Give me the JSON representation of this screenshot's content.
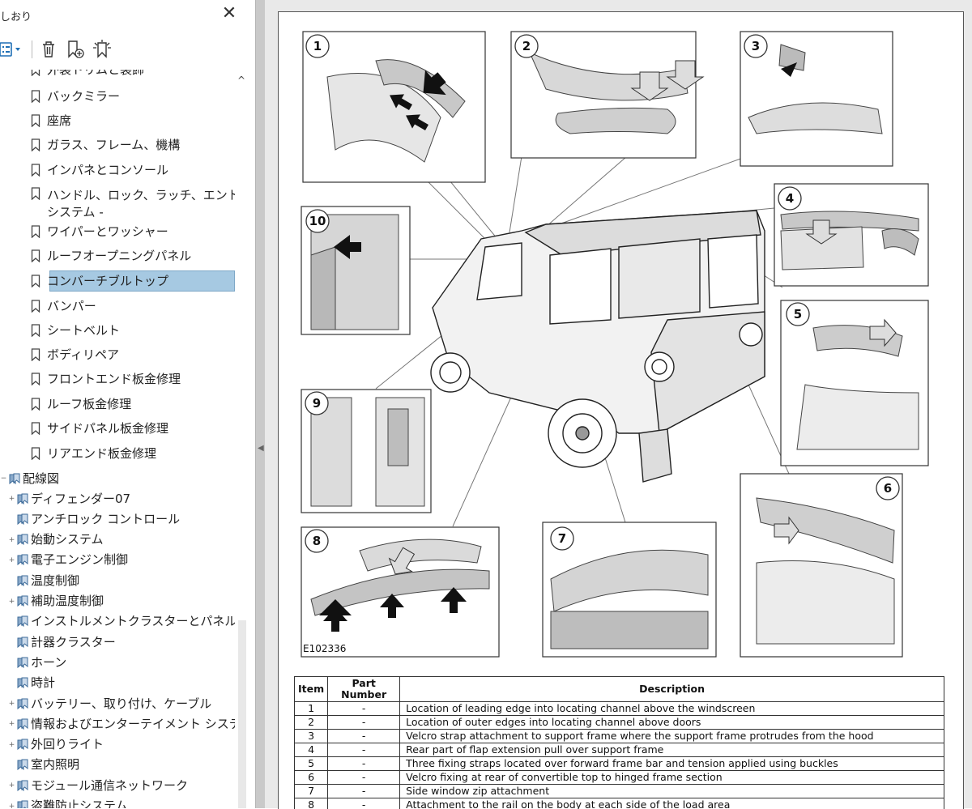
{
  "panel": {
    "title": "しおり",
    "close_glyph": "✕",
    "toolbar": {
      "options_icon": "list-options-icon",
      "delete_icon": "trash-icon",
      "new_bookmark_icon": "new-bookmark-icon",
      "find_bookmark_icon": "find-current-bookmark-icon"
    },
    "bookmarks": [
      {
        "label": "外装トリムと装飾"
      },
      {
        "label": "バックミラー"
      },
      {
        "label": "座席"
      },
      {
        "label": "ガラス、フレーム、機構"
      },
      {
        "label": "インパネとコンソール"
      },
      {
        "label": "ハンドル、ロック、ラッチ、エントリーシステム -",
        "line1": "ハンドル、ロック、ラッチ、エントリー",
        "line2": "システム -"
      },
      {
        "label": "ワイパーとワッシャー"
      },
      {
        "label": "ルーフオープニングパネル"
      },
      {
        "label": "コンバーチブルトップ",
        "selected": true
      },
      {
        "label": "バンパー"
      },
      {
        "label": "シートベルト"
      },
      {
        "label": "ボディリペア"
      },
      {
        "label": "フロントエンド板金修理"
      },
      {
        "label": "ルーフ板金修理"
      },
      {
        "label": "サイドパネル板金修理"
      },
      {
        "label": "リアエンド板金修理"
      }
    ],
    "wiring_section": {
      "label": "配線図",
      "children": [
        {
          "label": "ディフェンダー07",
          "expand": "+"
        },
        {
          "label": "アンチロック コントロール",
          "expand": ""
        },
        {
          "label": "始動システム",
          "expand": "+"
        },
        {
          "label": "電子エンジン制御",
          "expand": "+"
        },
        {
          "label": "温度制御",
          "expand": ""
        },
        {
          "label": "補助温度制御",
          "expand": "+"
        },
        {
          "label": "インストルメントクラスターとパネル照明",
          "expand": ""
        },
        {
          "label": "計器クラスター",
          "expand": ""
        },
        {
          "label": "ホーン",
          "expand": ""
        },
        {
          "label": "時計",
          "expand": ""
        },
        {
          "label": "バッテリー、取り付け、ケーブル",
          "expand": "+"
        },
        {
          "label": "情報およびエンターテイメント システム",
          "expand": "+"
        },
        {
          "label": "外回りライト",
          "expand": "+"
        },
        {
          "label": "室内照明",
          "expand": ""
        },
        {
          "label": "モジュール通信ネットワーク",
          "expand": "+"
        },
        {
          "label": "盗難防止システム",
          "expand": "+"
        }
      ]
    }
  },
  "figure": {
    "callouts": [
      "1",
      "2",
      "3",
      "4",
      "5",
      "6",
      "7",
      "8",
      "9",
      "10"
    ],
    "figure_id": "E102336"
  },
  "table": {
    "headers": {
      "item": "Item",
      "part_number": "Part Number",
      "description": "Description"
    },
    "rows": [
      {
        "item": "1",
        "part": "-",
        "desc": "Location of leading edge into locating channel above the windscreen"
      },
      {
        "item": "2",
        "part": "-",
        "desc": "Location of outer edges into locating channel above doors"
      },
      {
        "item": "3",
        "part": "-",
        "desc": "Velcro strap attachment to support frame where the support frame protrudes from the hood"
      },
      {
        "item": "4",
        "part": "-",
        "desc": "Rear part of flap extension pull over support frame"
      },
      {
        "item": "5",
        "part": "-",
        "desc": "Three fixing straps located over forward frame bar and tension applied using buckles"
      },
      {
        "item": "6",
        "part": "-",
        "desc": "Velcro fixing at rear of convertible top to hinged frame section"
      },
      {
        "item": "7",
        "part": "-",
        "desc": "Side window zip attachment"
      },
      {
        "item": "8",
        "part": "-",
        "desc": "Attachment to the rail on the body at each side of the load area"
      }
    ]
  }
}
